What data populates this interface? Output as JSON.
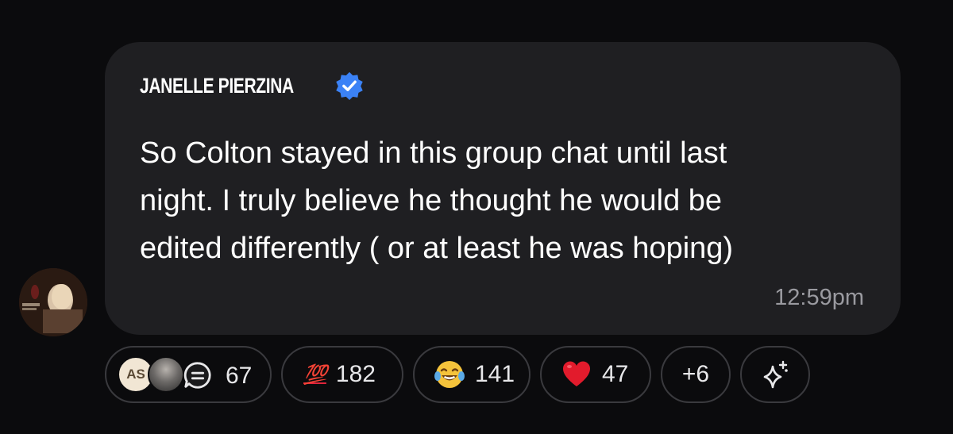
{
  "message": {
    "sender": "JANELLE PIERZINA",
    "text": "So Colton stayed in this group chat until last\nnight. I truly believe he thought he would be\nedited differently ( or at least he was hoping)",
    "timestamp": "12:59pm"
  },
  "avatar": {
    "description_icon": "user-photo-avatar"
  },
  "reactions": {
    "reply_avatar_initials": "AS",
    "reply_count": "67",
    "items": [
      {
        "icon": "hundred-points-emoji",
        "label": "💯",
        "count": "182"
      },
      {
        "icon": "laughing-tears-emoji",
        "count": "141"
      },
      {
        "icon": "red-heart-emoji",
        "count": "47"
      },
      {
        "label": "+6"
      }
    ]
  },
  "colors": {
    "background": "#0b0b0d",
    "bubble": "#1f1f22",
    "verified_badge": "#3b82f6",
    "pill_border": "#3a3a3e",
    "timestamp": "#9a9aa0"
  }
}
